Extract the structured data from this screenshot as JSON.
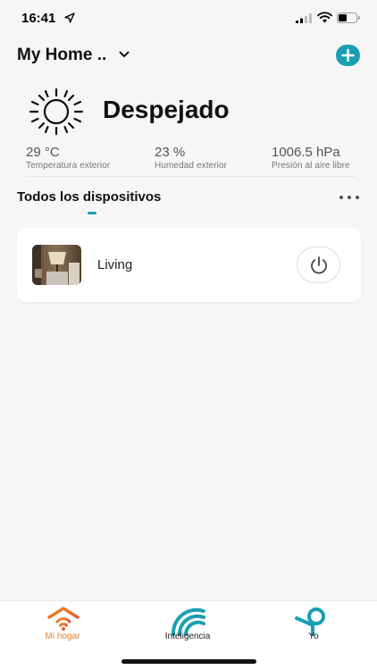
{
  "status_bar": {
    "time": "16:41"
  },
  "header": {
    "home_name": "My Home .."
  },
  "weather": {
    "condition": "Despejado",
    "temperature": {
      "value": "29 °C",
      "label": "Temperatura exterior"
    },
    "humidity": {
      "value": "23 %",
      "label": "Humedad exterior"
    },
    "pressure": {
      "value": "1006.5 hPa",
      "label": "Presión al aire libre"
    }
  },
  "devices_section": {
    "title": "Todos los dispositivos"
  },
  "devices": [
    {
      "name": "Living"
    }
  ],
  "tabbar": {
    "home_label": "Mi hogar",
    "intelligence_label": "Inteligencia",
    "me_label": "Yo"
  },
  "colors": {
    "accent": "#1a9fb2",
    "active_tab": "#e57a2a",
    "background": "#f6f6f7"
  },
  "icons": [
    "location-arrow-icon",
    "signal-icon",
    "wifi-icon",
    "battery-icon",
    "chevron-down-icon",
    "plus-icon",
    "sun-icon",
    "more-icon",
    "power-icon",
    "home-wifi-icon",
    "intelligence-icon",
    "profile-icon"
  ]
}
